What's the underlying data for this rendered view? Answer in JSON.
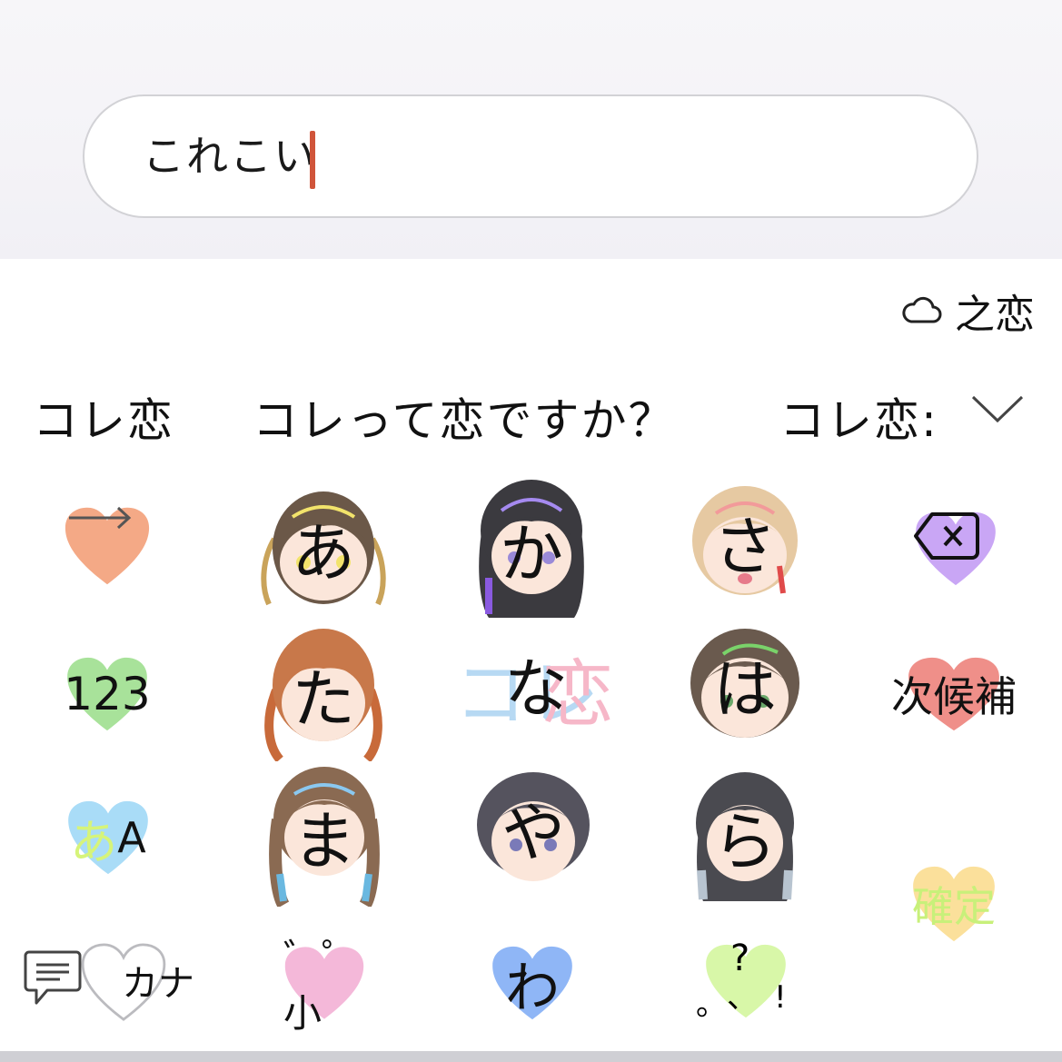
{
  "input": {
    "value": "これこい"
  },
  "cloud": {
    "text": "之恋",
    "icon": "cloud-icon"
  },
  "candidates": [
    {
      "label": "コレ恋"
    },
    {
      "label": "コレって恋ですか？"
    },
    {
      "label": "コレ恋:"
    }
  ],
  "candidates_expand_icon": "chevron-down-icon",
  "keys": {
    "arrow": {
      "icon": "arrow-right-icon",
      "color": "#f4a986"
    },
    "a": {
      "label": "あ"
    },
    "ka": {
      "label": "か"
    },
    "sa": {
      "label": "さ"
    },
    "backspace": {
      "icon": "backspace-icon",
      "color": "#c9a6f5"
    },
    "num": {
      "label": "123",
      "color": "#a8e29a"
    },
    "ta": {
      "label": "た"
    },
    "na": {
      "label": "な"
    },
    "ha": {
      "label": "は"
    },
    "next": {
      "label": "次候補",
      "color": "#ef8f89"
    },
    "mode": {
      "label_a": "あ",
      "label_b": "A",
      "color": "#a9dcf7"
    },
    "ma": {
      "label": "ま"
    },
    "ya": {
      "label": "や"
    },
    "ra": {
      "label": "ら"
    },
    "confirm": {
      "label": "確定",
      "color": "#fbe09b"
    },
    "emoji": {
      "label": "カナ",
      "icon": "chat-icon"
    },
    "dakuten": {
      "label": "゛゜小",
      "color": "#f4b8d9"
    },
    "wa": {
      "label": "わ",
      "color": "#8fb6f6"
    },
    "punct": {
      "q": "?",
      "p1": "。",
      "p2": "、",
      "ex": "!",
      "color": "#d8f7a8"
    }
  },
  "logo": {
    "text_a": "コレ",
    "text_b": "恋"
  },
  "colors": {
    "caret": "#d0553a",
    "confirm_text": "#c8f07a",
    "mode_a": "#d6f47a"
  }
}
